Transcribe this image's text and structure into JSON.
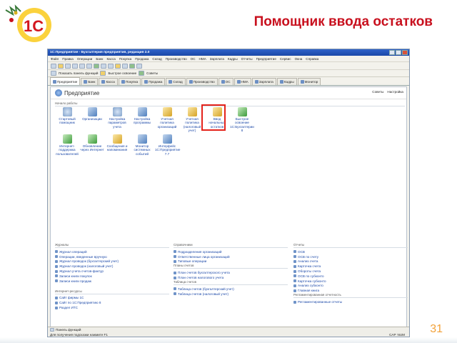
{
  "slide": {
    "title": "Помощник ввода остатков",
    "page_number": "31"
  },
  "window": {
    "title": "1С:Предприятие - Бухгалтерия предприятия, редакция 2.0",
    "menu": [
      "Файл",
      "Правка",
      "Операции",
      "Банк",
      "Касса",
      "Покупка",
      "Продажа",
      "Склад",
      "Производство",
      "ОС",
      "НМА",
      "Зарплата",
      "Кадры",
      "Отчеты",
      "Предприятие",
      "Сервис",
      "Окна",
      "Справка"
    ],
    "toolbar2": {
      "show_panel": "Показать панель функций",
      "quick_start": "Быстрое освоение",
      "tips": "Советы"
    },
    "tabs": [
      "Предприятие",
      "Банк",
      "Касса",
      "Покупка",
      "Продажа",
      "Склад",
      "Производство",
      "ОС",
      "НМА",
      "Зарплата",
      "Кадры",
      "Монитор"
    ],
    "panel": {
      "title": "Предприятие",
      "right_links": [
        "Советы",
        "Настройка"
      ],
      "section_label": "Начало работы",
      "icons_row1": [
        "Стартовый помощник",
        "Организации",
        "Настройка параметров учета",
        "Настройка программы",
        "Учетная политика организаций",
        "Учетная политика (налоговый учет)",
        "Ввод начальных остатков",
        "Быстрое освоение 1С:Бухгалтерии 8"
      ],
      "icons_row2": [
        "Интернет-поддержка пользователей",
        "Обновление через Интернет",
        "Сообщения и напоминания",
        "Монитор системных событий",
        "Интерфейс 1С:Предприятие 7.7"
      ],
      "highlighted": "Ввод начальных остатков",
      "journals": {
        "title": "Журналы",
        "items": [
          "Журнал операций",
          "Операции, введенные вручную",
          "Журнал проводок (бухгалтерский учет)",
          "Журнал проводок (налоговый учет)",
          "Журнал учета счетов-фактур",
          "Записи книги покупок",
          "Записи книги продаж"
        ]
      },
      "internet": {
        "title": "Интернет-ресурсы",
        "items": [
          "Сайт фирмы 1С",
          "Сайт по 1С:Предприятию 8",
          "Раздел ИТС"
        ]
      },
      "refs": {
        "title": "Справочники",
        "items": [
          "Подразделения организаций",
          "Ответственные лица организаций",
          "Типовые операции"
        ]
      },
      "charts": {
        "title": "Планы счетов",
        "items": [
          "План счетов бухгалтерского учета",
          "План счетов налогового учета"
        ]
      },
      "tables": {
        "title": "Таблица счетов",
        "items": [
          "Таблица счетов (бухгалтерский учет)",
          "Таблица счетов (налоговый учет)"
        ]
      },
      "reports": {
        "title": "Отчеты",
        "items": [
          "ОСВ",
          "ОСВ по счету",
          "Анализ счета",
          "Карточка счета",
          "Обороты счета",
          "ОСВ по субконто",
          "Карточка субконто",
          "Анализ субконто",
          "Главная книга"
        ]
      },
      "reg_reports": {
        "title": "Регламентированная отчетность",
        "items": [
          "Регламентированные отчеты"
        ]
      }
    },
    "status": {
      "panel_btn": "Панель функций",
      "hint": "Для получения подсказки нажмите F1",
      "keys": [
        "CAP",
        "NUM"
      ]
    }
  },
  "colors": {
    "accent_red": "#c8101e",
    "highlight": "#e4231b",
    "link": "#1b48a8",
    "page_num": "#f2a23a"
  }
}
